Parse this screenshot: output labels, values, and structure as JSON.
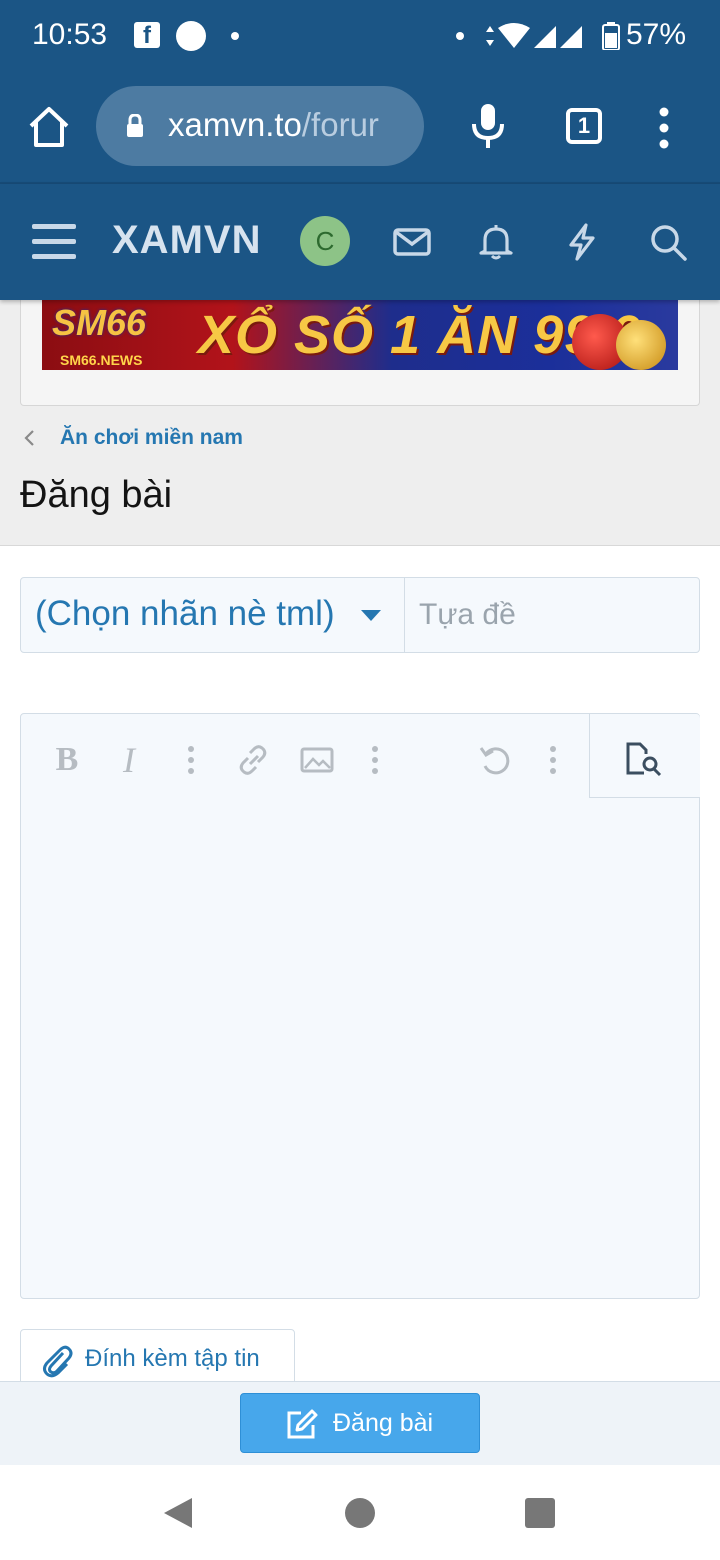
{
  "status_bar": {
    "time": "10:53",
    "battery": "57%",
    "color": "#1b5585"
  },
  "browser": {
    "url_main": "xamvn.to",
    "url_dim": "/forur",
    "tab_count": "1"
  },
  "site_header": {
    "logo": "XAMVN",
    "avatar_letter": "C",
    "icons": [
      "hamburger-icon",
      "mail-icon",
      "bell-icon",
      "bolt-icon",
      "search-icon"
    ]
  },
  "banner": {
    "logo_text": "SM66",
    "sub_text": "SM66.NEWS",
    "headline": "XỔ SỐ 1 ĂN 99.9"
  },
  "breadcrumb": {
    "label": "Ăn chơi miền nam"
  },
  "page": {
    "title": "Đăng bài"
  },
  "form": {
    "prefix_label": "(Chọn nhãn nè tml)",
    "title_placeholder": "Tựa đề",
    "title_value": "",
    "toolbar": {
      "bold": "B",
      "italic": "I"
    },
    "attach_label": "Đính kèm tập tin",
    "submit_label": "Đăng bài"
  },
  "colors": {
    "header": "#1b5585",
    "link": "#2577b1",
    "button": "#47a7eb"
  }
}
